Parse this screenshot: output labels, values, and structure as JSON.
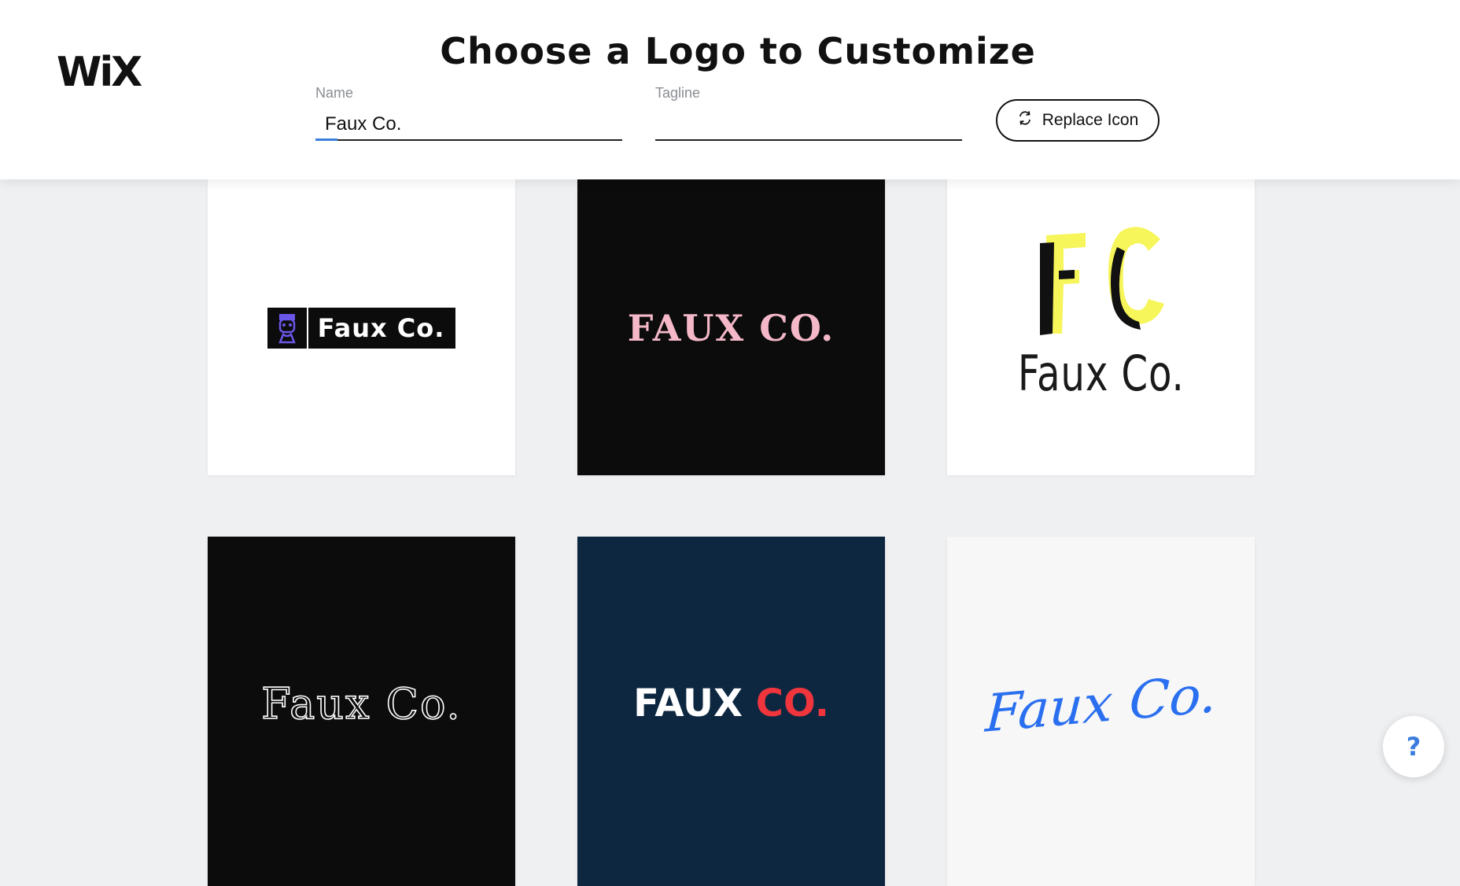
{
  "header": {
    "brand": "WiX",
    "title": "Choose a Logo to Customize"
  },
  "form": {
    "name_label": "Name",
    "name_value": "Faux Co.",
    "tagline_label": "Tagline",
    "tagline_value": "",
    "replace_icon_label": "Replace Icon"
  },
  "logos": [
    {
      "text": "Faux Co.",
      "style": "badge-dark-icon",
      "bg": "#ffffff"
    },
    {
      "text": "FAUX CO.",
      "style": "pink-serif",
      "bg": "#0c0c0c",
      "color": "#f4b8c8"
    },
    {
      "monogram": "FC",
      "text": "Faux Co.",
      "style": "monogram-yellow",
      "bg": "#ffffff",
      "accent": "#f6f55a"
    },
    {
      "text": "Faux Co.",
      "style": "outline-serif",
      "bg": "#0c0c0c"
    },
    {
      "text_a": "FAUX",
      "text_b": "CO.",
      "style": "two-tone",
      "bg": "#0e2741",
      "accent": "#f0353d"
    },
    {
      "text": "Faux Co.",
      "style": "blue-script",
      "bg": "#f7f7f7",
      "color": "#2a6ff0"
    }
  ],
  "help": {
    "label": "?"
  },
  "colors": {
    "accent": "#3b7ddd"
  }
}
